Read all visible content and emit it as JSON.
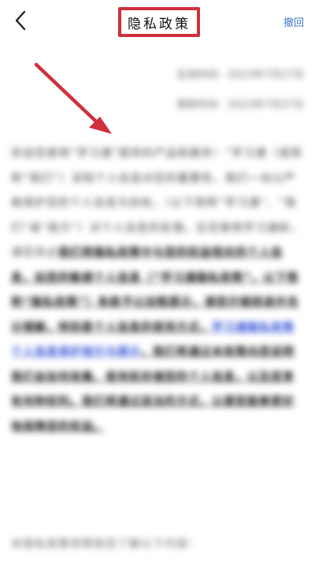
{
  "nav": {
    "back_icon": "chevron-left-icon",
    "title": "隐私政策",
    "withdraw_label": "撤回"
  },
  "meta": {
    "effective_date": "生效时间：2023年7月27日",
    "update_date": "更新时间：2023年7月27日"
  },
  "body": {
    "intro": "欢迎您使用“学习通”提供的产品和服务！“学习通（或简称“我们”）深知个人信息对您的重要性，我们一向以严格保护您的个人信息为目标，（以下简称“学习通”、“我们”或“我方”）对个人信息的处理。在您使用学习通前，请您务必",
    "bold_part": "我们将隐私政策中与您的权益相关的个人信息，如您的敏感个人信息（“学习通隐私政策”，以下简称“隐私政策”）条款予以加粗提示，",
    "middle": "请您仔细阅读并充分理解，特别是个人信息的使用方式，",
    "link_text": "学习通隐私政策个人信息保护指引与提示",
    "bold_tail": "，我们将通过本政策向您说明我们会如何收集、使用和存储您的个人信息，以及您享有何种权利。我们将通过适当的方式，以便您能够更好地保障您的权益。",
    "tail": "本隐私政策将帮助您了解以下内容："
  },
  "annotations": {
    "accent_color": "#d0303e",
    "link_color": "#2f4fd6"
  }
}
